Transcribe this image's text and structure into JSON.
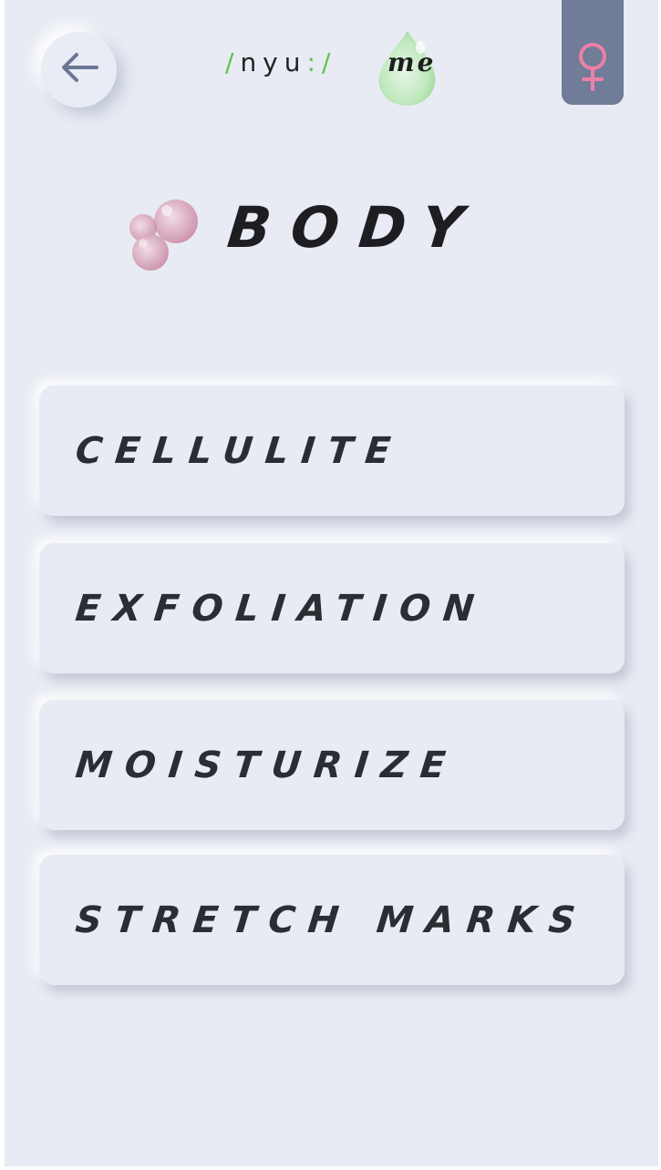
{
  "header": {
    "back_icon": "arrow-left-icon",
    "logo": {
      "slash_1": "/",
      "word": "nyu",
      "colon": ":",
      "slash_2": "/",
      "suffix": "me"
    },
    "gender_icon": "female-symbol-icon",
    "gender_tab_color": "#707c98",
    "gender_icon_color": "#ee7fa6"
  },
  "title": {
    "text": "BODY",
    "decoration_icon": "pink-bubbles-icon"
  },
  "categories": [
    {
      "label": "CELLULITE"
    },
    {
      "label": "EXFOLIATION"
    },
    {
      "label": "MOISTURIZE"
    },
    {
      "label": "STRETCH MARKS"
    }
  ],
  "colors": {
    "background": "#e8ebf3",
    "text": "#2b2d33",
    "accent_green": "#5cc24a",
    "accent_pink": "#ee7fa6",
    "back_arrow": "#6a7694"
  }
}
